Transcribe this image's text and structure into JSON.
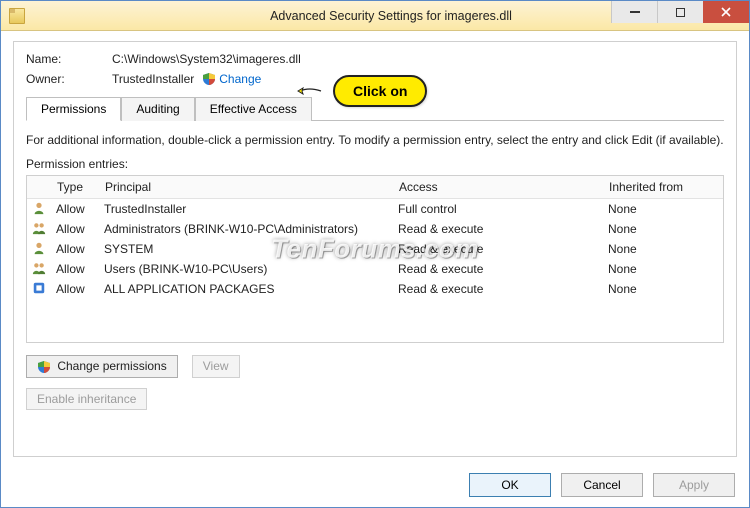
{
  "titlebar": {
    "title": "Advanced Security Settings for imageres.dll"
  },
  "header": {
    "name_label": "Name:",
    "name_value": "C:\\Windows\\System32\\imageres.dll",
    "owner_label": "Owner:",
    "owner_value": "TrustedInstaller",
    "change_link": "Change"
  },
  "tabs": [
    {
      "label": "Permissions",
      "active": true
    },
    {
      "label": "Auditing",
      "active": false
    },
    {
      "label": "Effective Access",
      "active": false
    }
  ],
  "info_text": "For additional information, double-click a permission entry. To modify a permission entry, select the entry and click Edit (if available).",
  "entries_label": "Permission entries:",
  "grid": {
    "headers": {
      "type": "Type",
      "principal": "Principal",
      "access": "Access",
      "inherited": "Inherited from"
    },
    "rows": [
      {
        "icon": "user",
        "type": "Allow",
        "principal": "TrustedInstaller",
        "access": "Full control",
        "inherited": "None"
      },
      {
        "icon": "group",
        "type": "Allow",
        "principal": "Administrators (BRINK-W10-PC\\Administrators)",
        "access": "Read & execute",
        "inherited": "None"
      },
      {
        "icon": "user",
        "type": "Allow",
        "principal": "SYSTEM",
        "access": "Read & execute",
        "inherited": "None"
      },
      {
        "icon": "group",
        "type": "Allow",
        "principal": "Users (BRINK-W10-PC\\Users)",
        "access": "Read & execute",
        "inherited": "None"
      },
      {
        "icon": "pkg",
        "type": "Allow",
        "principal": "ALL APPLICATION PACKAGES",
        "access": "Read & execute",
        "inherited": "None"
      }
    ]
  },
  "buttons": {
    "change_perms": "Change permissions",
    "view": "View",
    "enable_inh": "Enable inheritance",
    "ok": "OK",
    "cancel": "Cancel",
    "apply": "Apply"
  },
  "callout": {
    "text": "Click on"
  },
  "watermark": "TenForums.com"
}
